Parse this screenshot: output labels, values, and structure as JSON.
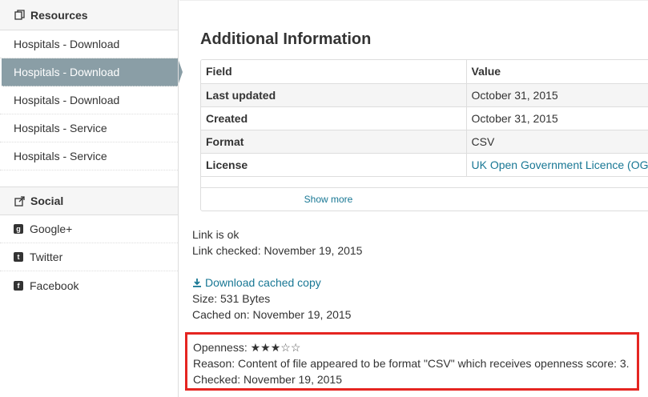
{
  "sidebar": {
    "resources_heading": "Resources",
    "resources": [
      {
        "label": "Hospitals - Download",
        "active": false
      },
      {
        "label": "Hospitals - Download",
        "active": true
      },
      {
        "label": "Hospitals - Download",
        "active": false
      },
      {
        "label": "Hospitals - Service",
        "active": false
      },
      {
        "label": "Hospitals - Service",
        "active": false
      }
    ],
    "social_heading": "Social",
    "social": [
      {
        "label": "Google+",
        "icon": "google-plus-icon"
      },
      {
        "label": "Twitter",
        "icon": "twitter-icon"
      },
      {
        "label": "Facebook",
        "icon": "facebook-icon"
      }
    ]
  },
  "main": {
    "title": "Additional Information",
    "table": {
      "headers": [
        "Field",
        "Value"
      ],
      "rows": [
        {
          "field": "Last updated",
          "value": "October 31, 2015"
        },
        {
          "field": "Created",
          "value": "October 31, 2015"
        },
        {
          "field": "Format",
          "value": "CSV"
        },
        {
          "field": "License",
          "value": "UK Open Government Licence (OG"
        }
      ],
      "show_more": "Show more"
    },
    "link_status": "Link is ok",
    "link_checked": "Link checked: November 19, 2015",
    "download_cached": "Download cached copy",
    "size": "Size: 531 Bytes",
    "cached_on": "Cached on: November 19, 2015",
    "openness": {
      "label": "Openness:",
      "stars_filled": 3,
      "stars_total": 5,
      "reason": "Reason: Content of file appeared to be format \"CSV\" which receives openness score: 3.",
      "checked": "Checked: November 19, 2015"
    }
  },
  "colors": {
    "accent": "#187794",
    "active_nav": "#8a9ea6",
    "highlight_border": "#e52521"
  }
}
